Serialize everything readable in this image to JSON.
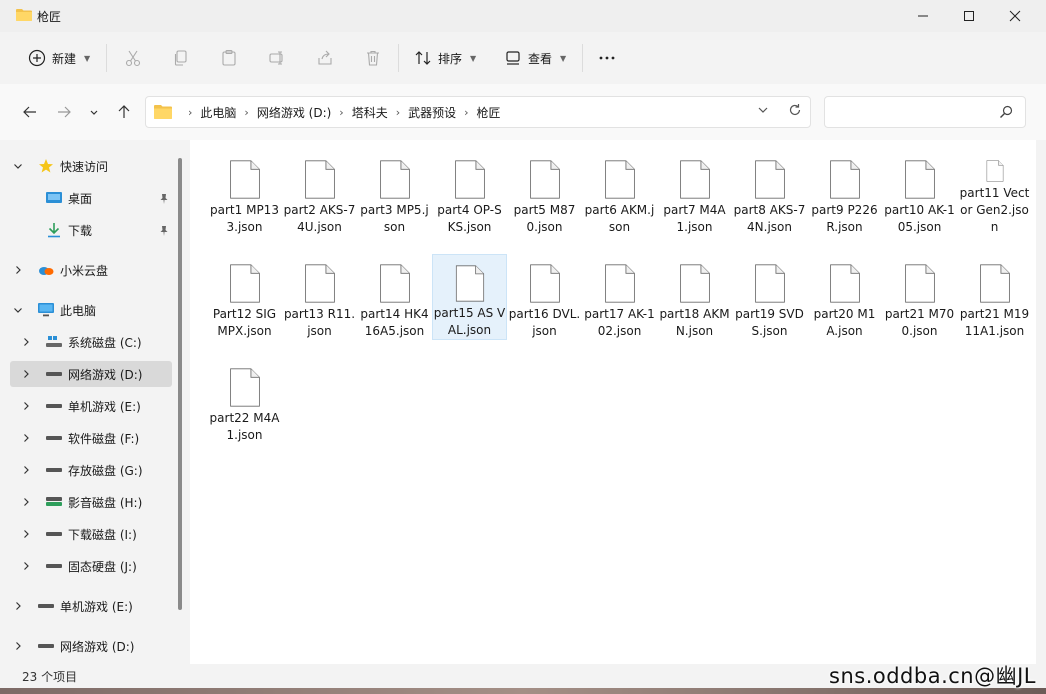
{
  "window": {
    "title": "枪匠"
  },
  "toolbar": {
    "new_label": "新建",
    "sort_label": "排序",
    "view_label": "查看"
  },
  "breadcrumbs": [
    "此电脑",
    "网络游戏 (D:)",
    "塔科夫",
    "武器预设",
    "枪匠"
  ],
  "search": {
    "placeholder": ""
  },
  "sidebar": {
    "quick_access": "快速访问",
    "desktop": "桌面",
    "downloads": "下载",
    "cloud": "小米云盘",
    "this_pc": "此电脑",
    "drives": [
      "系统磁盘 (C:)",
      "网络游戏 (D:)",
      "单机游戏 (E:)",
      "软件磁盘 (F:)",
      "存放磁盘 (G:)",
      "影音磁盘 (H:)",
      "下载磁盘 (I:)",
      "固态硬盘 (J:)"
    ],
    "extra_e": "单机游戏 (E:)",
    "extra_d": "网络游戏 (D:)"
  },
  "files": [
    "part1 MP133.json",
    "part2 AKS-74U.json",
    "part3 MP5.json",
    "part4 OP-SKS.json",
    "part5 M870.json",
    "part6 AKM.json",
    "part7 M4A1.json",
    "part8 AKS-74N.json",
    "part9 P226R.json",
    "part10 AK-105.json",
    "part11 Vector Gen2.json",
    "Part12 SIG MPX.json",
    "part13 R11.json",
    "part14 HK416A5.json",
    "part15 AS VAL.json",
    "part16 DVL.json",
    "part17 AK-102.json",
    "part18 AKMN.json",
    "part19 SVDS.json",
    "part20 M1A.json",
    "part21 M700.json",
    "part21 M1911A1.json",
    "part22 M4A1.json"
  ],
  "status": {
    "count": "23 个项目"
  },
  "watermark": "sns.oddba.cn@幽JL"
}
